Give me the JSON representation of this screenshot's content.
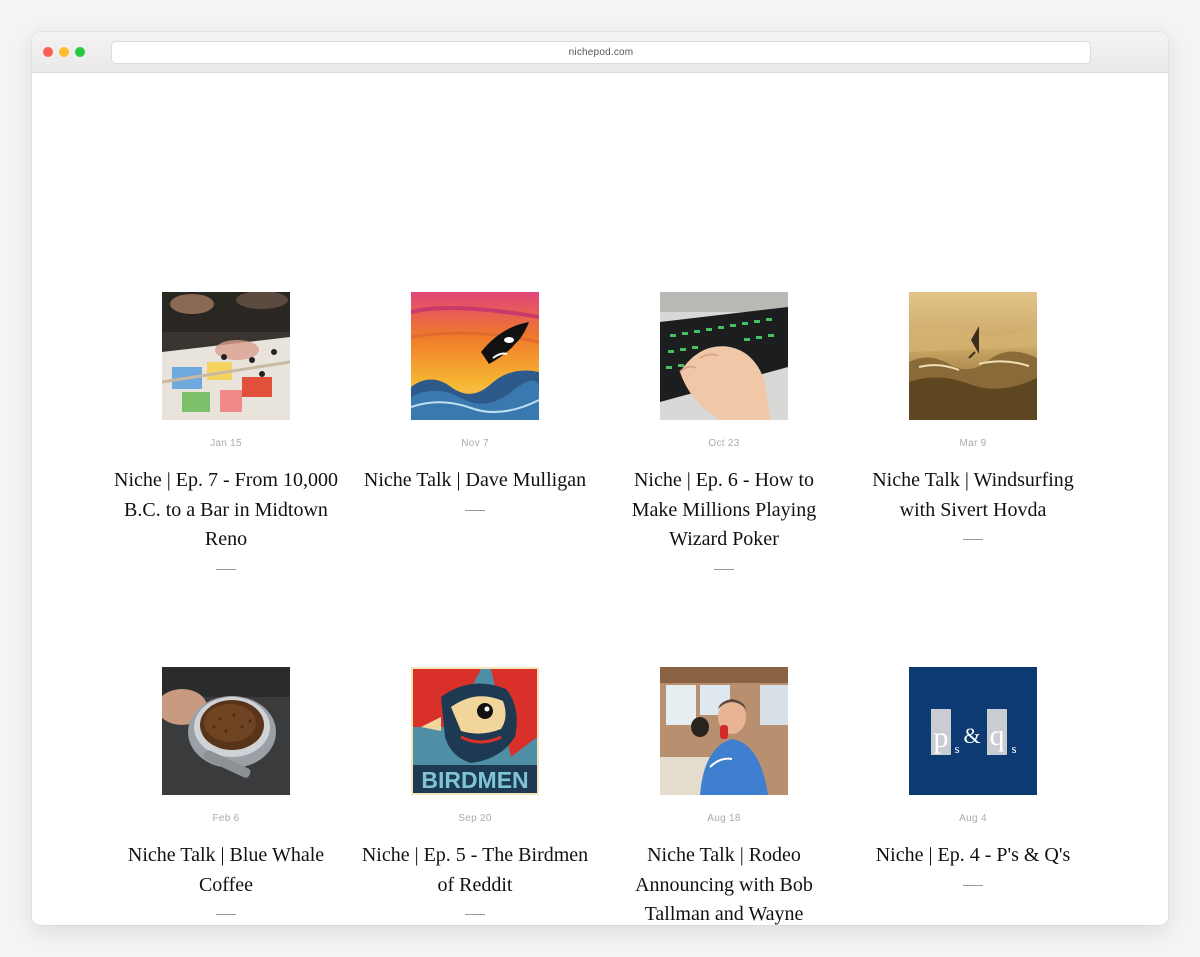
{
  "browser": {
    "url": "nichepod.com"
  },
  "posts": [
    {
      "date": "Jan 15",
      "title": "Niche | Ep. 7 - From 10,000 B.C. to a Bar in Midtown Reno"
    },
    {
      "date": "Nov 7",
      "title": "Niche Talk | Dave Mulligan"
    },
    {
      "date": "Oct 23",
      "title": "Niche | Ep. 6 - How to Make Millions Playing Wizard Poker"
    },
    {
      "date": "Mar 9",
      "title": "Niche Talk | Windsurfing with Sivert Hovda"
    },
    {
      "date": "Feb 6",
      "title": "Niche Talk | Blue Whale Coffee"
    },
    {
      "date": "Sep 20",
      "title": "Niche | Ep. 5 - The Birdmen of Reddit"
    },
    {
      "date": "Aug 18",
      "title": "Niche Talk | Rodeo Announcing with Bob Tallman and Wayne"
    },
    {
      "date": "Aug 4",
      "title": "Niche | Ep. 4 - P's & Q's"
    }
  ],
  "thumb_text": {
    "birdmen": "BIRDMEN",
    "pq_p": "p",
    "pq_s1": "s",
    "pq_amp": "&",
    "pq_q": "q",
    "pq_s2": "s"
  }
}
